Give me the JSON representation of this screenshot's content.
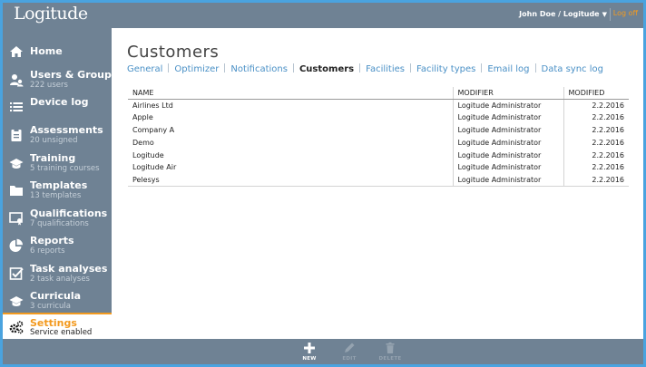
{
  "header": {
    "logo": "Logitude",
    "user": "John Doe / Logitude",
    "logoff": "Log off"
  },
  "sidebar": {
    "items": [
      {
        "label": "Home",
        "sub": "",
        "icon": "home-icon"
      },
      {
        "label": "Users & Groups",
        "sub": "222 users",
        "icon": "users-icon"
      },
      {
        "label": "Device log",
        "sub": "",
        "icon": "list-icon"
      },
      {
        "label": "Assessments",
        "sub": "20 unsigned",
        "icon": "clipboard-icon"
      },
      {
        "label": "Training",
        "sub": "5 training courses",
        "icon": "graduation-cap-icon"
      },
      {
        "label": "Templates",
        "sub": "13 templates",
        "icon": "folder-icon"
      },
      {
        "label": "Qualifications",
        "sub": "7 qualifications",
        "icon": "certificate-icon"
      },
      {
        "label": "Reports",
        "sub": "6 reports",
        "icon": "pie-chart-icon"
      },
      {
        "label": "Task analyses",
        "sub": "2 task analyses",
        "icon": "checkbox-icon"
      },
      {
        "label": "Curricula",
        "sub": "3 curricula",
        "icon": "graduation-cap-icon"
      }
    ],
    "settings": {
      "label": "Settings",
      "sub": "Service enabled",
      "icon": "gears-icon"
    }
  },
  "main": {
    "title": "Customers",
    "tabs": [
      {
        "label": "General"
      },
      {
        "label": "Optimizer"
      },
      {
        "label": "Notifications"
      },
      {
        "label": "Customers",
        "active": true
      },
      {
        "label": "Facilities"
      },
      {
        "label": "Facility types"
      },
      {
        "label": "Email log"
      },
      {
        "label": "Data sync log"
      }
    ],
    "table": {
      "columns": [
        "NAME",
        "MODIFIER",
        "MODIFIED"
      ],
      "rows": [
        [
          "Airlines Ltd",
          "Logitude Administrator",
          "2.2.2016"
        ],
        [
          "Apple",
          "Logitude Administrator",
          "2.2.2016"
        ],
        [
          "Company A",
          "Logitude Administrator",
          "2.2.2016"
        ],
        [
          "Demo",
          "Logitude Administrator",
          "2.2.2016"
        ],
        [
          "Logitude",
          "Logitude Administrator",
          "2.2.2016"
        ],
        [
          "Logitude Air",
          "Logitude Administrator",
          "2.2.2016"
        ],
        [
          "Pelesys",
          "Logitude Administrator",
          "2.2.2016"
        ]
      ]
    }
  },
  "actions": {
    "new": "NEW",
    "edit": "EDIT",
    "delete": "DELETE"
  },
  "colors": {
    "frame": "#4aa3df",
    "bar": "#6f8294",
    "accent": "#f39a1f",
    "link": "#4a90c6"
  }
}
